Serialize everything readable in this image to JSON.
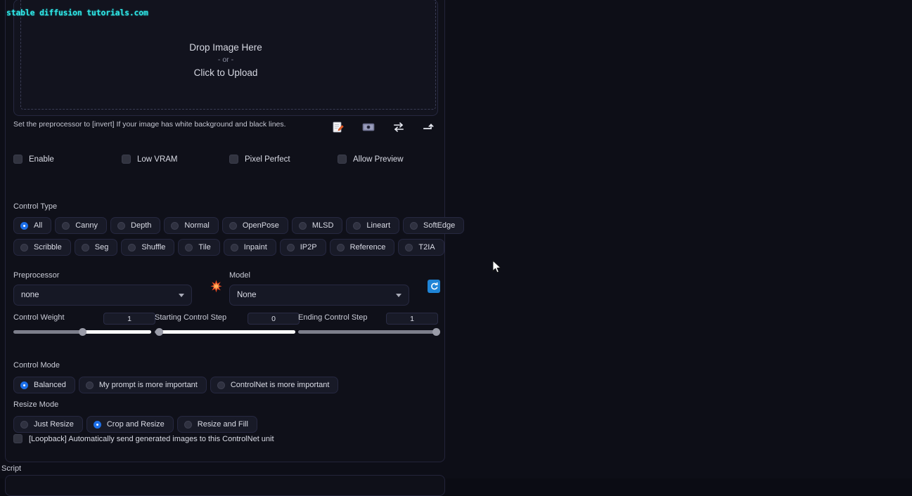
{
  "watermark": "stable diffusion tutorials.com",
  "image_drop": {
    "drop_label": "Drop Image Here",
    "or_label": "- or -",
    "upload_label": "Click to Upload"
  },
  "hint": {
    "text": "Set the preprocessor to [invert] If your image has white background and black lines.",
    "icons": [
      {
        "name": "edit-file-icon"
      },
      {
        "name": "webcam-icon"
      },
      {
        "name": "swap-arrows-icon"
      },
      {
        "name": "send-arrow-icon"
      }
    ]
  },
  "options": {
    "enable": "Enable",
    "low_vram": "Low VRAM",
    "pixel_perfect": "Pixel Perfect",
    "allow_preview": "Allow Preview"
  },
  "control_type": {
    "label": "Control Type",
    "selected": "All",
    "row1": [
      "All",
      "Canny",
      "Depth",
      "Normal",
      "OpenPose",
      "MLSD",
      "Lineart",
      "SoftEdge"
    ],
    "row2": [
      "Scribble",
      "Seg",
      "Shuffle",
      "Tile",
      "Inpaint",
      "IP2P",
      "Reference",
      "T2IA"
    ]
  },
  "preprocessor": {
    "label": "Preprocessor",
    "value": "none"
  },
  "model": {
    "label": "Model",
    "value": "None"
  },
  "sliders": {
    "control_weight": {
      "label": "Control Weight",
      "value": "1"
    },
    "starting_step": {
      "label": "Starting Control Step",
      "value": "0"
    },
    "ending_step": {
      "label": "Ending Control Step",
      "value": "1"
    }
  },
  "control_mode": {
    "label": "Control Mode",
    "selected": "Balanced",
    "items": [
      "Balanced",
      "My prompt is more important",
      "ControlNet is more important"
    ]
  },
  "resize_mode": {
    "label": "Resize Mode",
    "selected": "Crop and Resize",
    "items": [
      "Just Resize",
      "Crop and Resize",
      "Resize and Fill"
    ]
  },
  "loopback": {
    "label": "[Loopback] Automatically send generated images to this ControlNet unit"
  },
  "script": {
    "label": "Script"
  },
  "colors": {
    "accent_blue": "#1d6fe8",
    "watermark_cyan": "#2ee8e8",
    "refresh_blue": "#1f84d6",
    "background": "#0d0e17",
    "panel": "#0f1019"
  }
}
